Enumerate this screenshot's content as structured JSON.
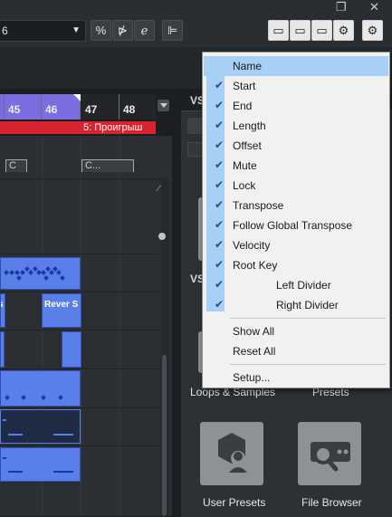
{
  "toolbar": {
    "combo_value": "6",
    "buttons": [
      {
        "name": "quantize-button",
        "glyph": "%"
      },
      {
        "name": "automation-button",
        "glyph": "⋫"
      },
      {
        "name": "edit-button",
        "glyph": "ℯ"
      },
      {
        "name": "align-button",
        "glyph": "⊫"
      }
    ],
    "layout_buttons": [
      {
        "name": "left-zone-toggle",
        "glyph": "▭"
      },
      {
        "name": "lower-zone-toggle",
        "glyph": "▭"
      },
      {
        "name": "right-zone-toggle",
        "glyph": "▭"
      },
      {
        "name": "setup-window-layout",
        "glyph": "⚙"
      },
      {
        "name": "settings",
        "glyph": "⚙"
      }
    ],
    "window_restore": "❐",
    "window_close": "✕"
  },
  "ruler": {
    "bars": [
      "45",
      "46",
      "47",
      "48"
    ]
  },
  "marker": {
    "label": "5: Проигрыш"
  },
  "chords": [
    "C",
    "C..."
  ],
  "parts": {
    "reverb_label": "Rever S",
    "left_fragment": "s"
  },
  "right_zone": {
    "vs_label": "VS",
    "vs_label2": "VS"
  },
  "media_tiles": [
    {
      "label": "Loops & Samples",
      "icon": "loops-icon"
    },
    {
      "label": "Presets",
      "icon": "presets-icon"
    },
    {
      "label": "User Presets",
      "icon": "user-presets-icon"
    },
    {
      "label": "File Browser",
      "icon": "file-browser-icon"
    }
  ],
  "menu": {
    "items": [
      {
        "label": "Name",
        "checked": false,
        "highlighted": true,
        "indent": false
      },
      {
        "label": "Start",
        "checked": true,
        "indent": false
      },
      {
        "label": "End",
        "checked": true,
        "indent": false
      },
      {
        "label": "Length",
        "checked": true,
        "indent": false
      },
      {
        "label": "Offset",
        "checked": true,
        "indent": false
      },
      {
        "label": "Mute",
        "checked": true,
        "indent": false
      },
      {
        "label": "Lock",
        "checked": true,
        "indent": false
      },
      {
        "label": "Transpose",
        "checked": true,
        "indent": false
      },
      {
        "label": "Follow Global Transpose",
        "checked": true,
        "indent": false
      },
      {
        "label": "Velocity",
        "checked": true,
        "indent": false
      },
      {
        "label": "Root Key",
        "checked": true,
        "indent": false
      },
      {
        "label": "Left Divider",
        "checked": true,
        "indent": true
      },
      {
        "label": "Right Divider",
        "checked": true,
        "indent": true
      }
    ],
    "actions": [
      "Show All",
      "Reset All"
    ],
    "setup": "Setup..."
  },
  "colors": {
    "accent_purple": "#7c6ee0",
    "marker_red": "#d8242f",
    "part_blue": "#5a7fe8",
    "menu_highlight": "#a8d0f5"
  }
}
